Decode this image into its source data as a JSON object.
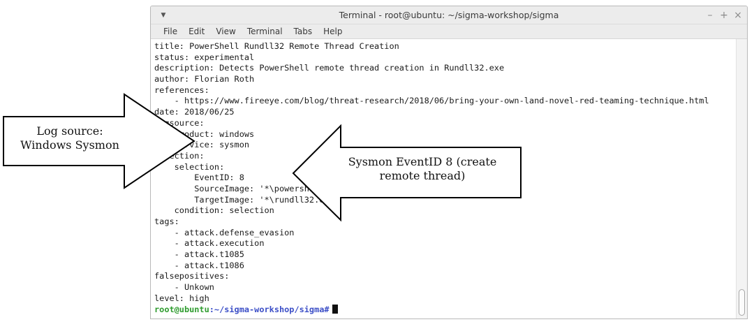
{
  "window": {
    "title": "Terminal - root@ubuntu: ~/sigma-workshop/sigma",
    "controls": {
      "minimize": "–",
      "maximize": "+",
      "close": "×"
    },
    "menu": [
      "File",
      "Edit",
      "View",
      "Terminal",
      "Tabs",
      "Help"
    ]
  },
  "terminal": {
    "lines": [
      "title: PowerShell Rundll32 Remote Thread Creation",
      "status: experimental",
      "description: Detects PowerShell remote thread creation in Rundll32.exe",
      "author: Florian Roth",
      "references:",
      "    - https://www.fireeye.com/blog/threat-research/2018/06/bring-your-own-land-novel-red-teaming-technique.html",
      "date: 2018/06/25",
      "logsource:",
      "    product: windows",
      "    service: sysmon",
      "detection:",
      "    selection:",
      "        EventID: 8",
      "        SourceImage: '*\\powershell.exe'",
      "        TargetImage: '*\\rundll32.exe'",
      "    condition: selection",
      "tags:",
      "    - attack.defense_evasion",
      "    - attack.execution",
      "    - attack.t1085",
      "    - attack.t1086",
      "falsepositives:",
      "    - Unkown",
      "level: high"
    ],
    "prompt": {
      "user": "root@ubuntu",
      "path": ":~/sigma-workshop/sigma",
      "symbol": "#"
    }
  },
  "callouts": {
    "log_source": {
      "line1": "Log source:",
      "line2": "Windows Sysmon"
    },
    "event_id": {
      "line1": "Sysmon EventID 8 (create",
      "line2": "remote thread)"
    }
  }
}
